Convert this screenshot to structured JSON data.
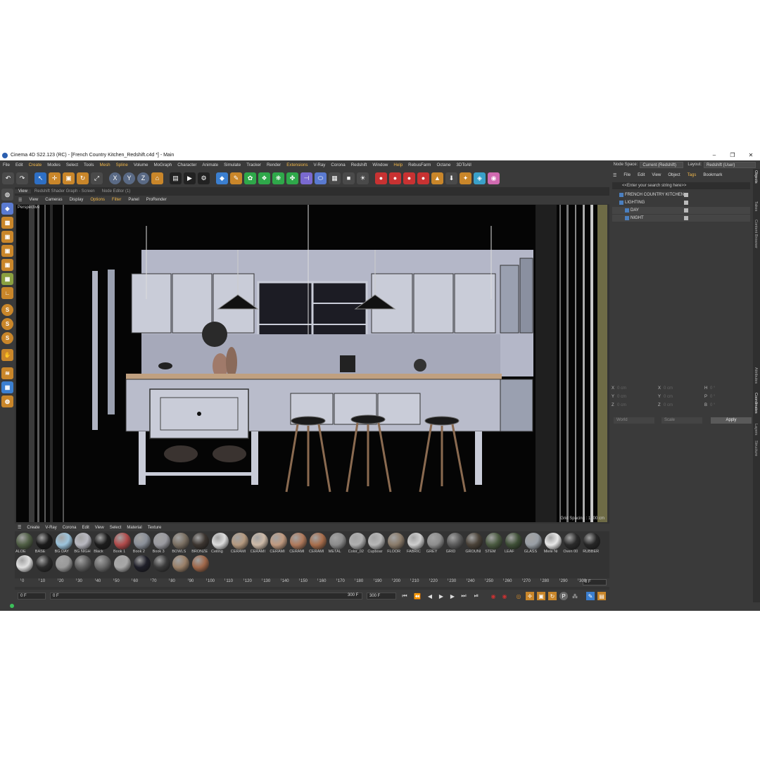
{
  "window": {
    "title": "Cinema 4D S22.123 (RC) - [French Country Kitchen_Redshift.c4d *] - Main",
    "minimize": "–",
    "maximize": "❐",
    "close": "✕"
  },
  "menubar": {
    "items": [
      "File",
      "Edit",
      "Create",
      "Modes",
      "Select",
      "Tools",
      "Mesh",
      "Spline",
      "Volume",
      "MoGraph",
      "Character",
      "Animate",
      "Simulate",
      "Tracker",
      "Render",
      "Extensions",
      "V-Ray",
      "Corona",
      "Redshift",
      "Window",
      "Help",
      "RebusFarm",
      "Octane",
      "3DToAll"
    ],
    "node_space_label": "Node Space:",
    "node_space_value": "Current (Redshift)",
    "layout_label": "Layout:",
    "layout_value": "Redshift (User)"
  },
  "view_tabs": [
    "View",
    "Redshift Shader Graph - Screen",
    "Node Editor (1)"
  ],
  "view_menu": [
    "View",
    "Cameras",
    "Display",
    "Options",
    "Filter",
    "Panel",
    "ProRender"
  ],
  "viewport": {
    "label": "Perspective",
    "grid_spacing": "Grid Spacing : 1000 cm"
  },
  "material_menu": [
    "Create",
    "V-Ray",
    "Corona",
    "Edit",
    "View",
    "Select",
    "Material",
    "Texture"
  ],
  "materials_row1": [
    {
      "name": "ALOE",
      "color": "#4f5e44"
    },
    {
      "name": "BASE",
      "color": "#1a1a1a"
    },
    {
      "name": "BG DAY",
      "color": "#9cc4dd"
    },
    {
      "name": "BG NIGH",
      "color": "#b8b8c0"
    },
    {
      "name": "Black",
      "color": "#1c1c1c"
    },
    {
      "name": "Book 1",
      "color": "#b04a4a"
    },
    {
      "name": "Book 2",
      "color": "#8a8f98"
    },
    {
      "name": "Book 3",
      "color": "#9a9aa0"
    },
    {
      "name": "BOWLS",
      "color": "#7a6f62"
    },
    {
      "name": "BRONZE",
      "color": "#3c3530"
    },
    {
      "name": "Ceiling",
      "color": "#dcdcdc"
    },
    {
      "name": "CERAMI",
      "color": "#b59a80"
    },
    {
      "name": "CERAMI",
      "color": "#cdbaa8"
    },
    {
      "name": "CERAMI",
      "color": "#c09a80"
    },
    {
      "name": "CERAMI",
      "color": "#b07a5c"
    },
    {
      "name": "CERAMI",
      "color": "#a86e4c"
    },
    {
      "name": "METAL",
      "color": "#8c8c8c"
    },
    {
      "name": "Color_02",
      "color": "#b0b0b0"
    },
    {
      "name": "Cupboar",
      "color": "#b8b8b8"
    },
    {
      "name": "FLOOR",
      "color": "#8a7b6a"
    },
    {
      "name": "FABRIC",
      "color": "#cfcfcf"
    },
    {
      "name": "GREY",
      "color": "#8e8e8e"
    },
    {
      "name": "GRID",
      "color": "#5a5a5a"
    },
    {
      "name": "GROUNI",
      "color": "#4a4238"
    },
    {
      "name": "STEM",
      "color": "#4a5a40"
    },
    {
      "name": "LEAF",
      "color": "#3e4f36"
    },
    {
      "name": "GLASS",
      "color": "#9aa0a6"
    },
    {
      "name": "Miele Ni",
      "color": "#e8e8e8"
    },
    {
      "name": "Oven 00",
      "color": "#2a2a2a"
    },
    {
      "name": "RUBBER",
      "color": "#262626"
    }
  ],
  "materials_row2": [
    {
      "name": "",
      "color": "#e0e0e0"
    },
    {
      "name": "",
      "color": "#2a2a2a"
    },
    {
      "name": "",
      "color": "#9a9a9a"
    },
    {
      "name": "",
      "color": "#5e5e5e"
    },
    {
      "name": "",
      "color": "#6a6a6a"
    },
    {
      "name": "",
      "color": "#a8a8a8"
    },
    {
      "name": "",
      "color": "#1e1e28"
    },
    {
      "name": "",
      "color": "#3a3a3a"
    },
    {
      "name": "",
      "color": "#9a8068"
    },
    {
      "name": "",
      "color": "#a0684a"
    }
  ],
  "timeline": {
    "ticks": [
      "0",
      "10",
      "20",
      "30",
      "40",
      "50",
      "60",
      "70",
      "80",
      "90",
      "100",
      "110",
      "120",
      "130",
      "140",
      "150",
      "160",
      "170",
      "180",
      "190",
      "200",
      "210",
      "220",
      "230",
      "240",
      "250",
      "260",
      "270",
      "280",
      "290",
      "300"
    ],
    "current_frame": "0 F"
  },
  "transport": {
    "start": "0 F",
    "current": "0 F",
    "end": "300 F",
    "max": "300 F"
  },
  "object_manager": {
    "menu": [
      "File",
      "Edit",
      "View",
      "Object",
      "Tags",
      "Bookmark"
    ],
    "search_placeholder": "<<Enter your search string here>>",
    "objects": [
      {
        "name": "FRENCH COUNTRY KITCHEN",
        "indent": 0
      },
      {
        "name": "LIGHTING",
        "indent": 0
      },
      {
        "name": "DAY",
        "indent": 1
      },
      {
        "name": "NIGHT",
        "indent": 1
      }
    ]
  },
  "coordinates": {
    "rows": [
      {
        "a": "X",
        "av": "0 cm",
        "b": "X",
        "bv": "0 cm",
        "c": "H",
        "cv": "0 °"
      },
      {
        "a": "Y",
        "av": "0 cm",
        "b": "Y",
        "bv": "0 cm",
        "c": "P",
        "cv": "0 °"
      },
      {
        "a": "Z",
        "av": "0 cm",
        "b": "Z",
        "bv": "0 cm",
        "c": "B",
        "cv": "0 °"
      }
    ],
    "mode1": "World",
    "mode2": "Scale",
    "apply": "Apply"
  },
  "side_tabs": [
    "Objects",
    "Takes",
    "Content Browser",
    "Attributes",
    "Coordinates",
    "Layers",
    "Structure"
  ]
}
